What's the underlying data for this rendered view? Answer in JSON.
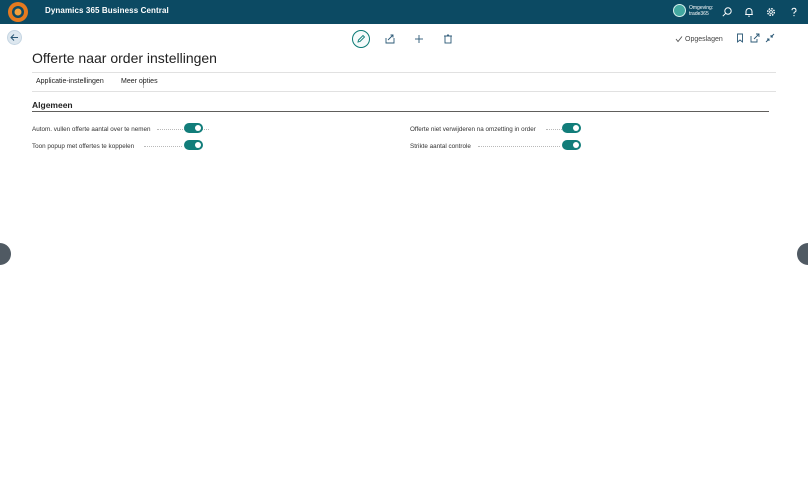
{
  "appbar": {
    "title": "Dynamics 365 Business Central",
    "environment_label": "Omgeving:",
    "environment_name": "trade365",
    "icons": [
      "search-icon",
      "bell-icon",
      "gear-icon",
      "help-icon"
    ]
  },
  "header": {
    "saved_label": "Opgeslagen",
    "title": "Offerte naar order instellingen"
  },
  "actions": {
    "app_settings": "Applicatie-instellingen",
    "more_options": "Meer opties"
  },
  "section": {
    "title": "Algemeen",
    "fields": [
      {
        "label": "Autom. vullen offerte aantal over te nemen",
        "value": true
      },
      {
        "label": "Toon popup met offertes te koppelen",
        "value": true
      },
      {
        "label": "Offerte niet verwijderen na omzetting in order",
        "value": true
      },
      {
        "label": "Strikte aantal controle",
        "value": true
      }
    ]
  },
  "colors": {
    "appbar": "#0c4a63",
    "accent": "#127d7a"
  }
}
